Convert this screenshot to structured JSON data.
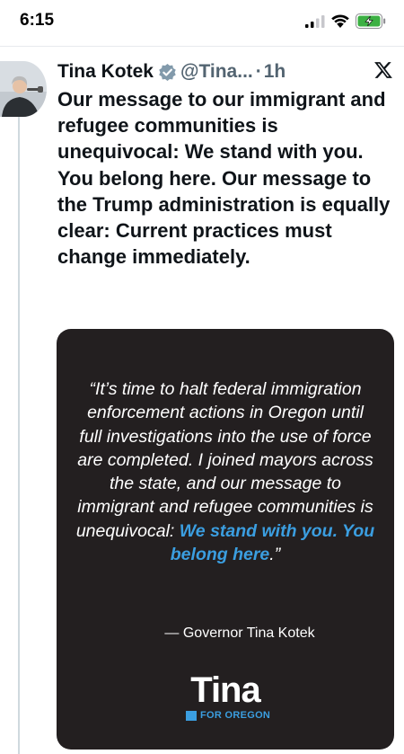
{
  "status_bar": {
    "time": "6:15",
    "icons": [
      "signal-icon",
      "wifi-icon",
      "battery-charging-icon"
    ],
    "battery_color": "#3cb043"
  },
  "tweet": {
    "author": {
      "display_name": "Tina Kotek",
      "handle": "@Tina...",
      "verified_badge": "verified-badge-icon"
    },
    "separator": "·",
    "time": "1h",
    "platform_icon": "x-logo-icon",
    "text": "Our message to our immigrant and refugee communities is unequivocal: We stand with you. You belong here. Our message to the Trump administration is equally clear: Current practices must change immediately.",
    "media": {
      "quote_before": "“It’s time to halt federal immigration enforcement actions in Oregon until full investigations into the use of force are completed. I joined mayors across the state, and our message to immigrant and refugee communities is unequivocal: ",
      "quote_highlight": "We stand with you. You belong here",
      "quote_after": ".”",
      "attribution": "— Governor Tina Kotek",
      "brand_name": "Tina",
      "brand_subtitle": "FOR OREGON",
      "background_color": "#231f20",
      "accent_color": "#3b9ee0"
    }
  }
}
